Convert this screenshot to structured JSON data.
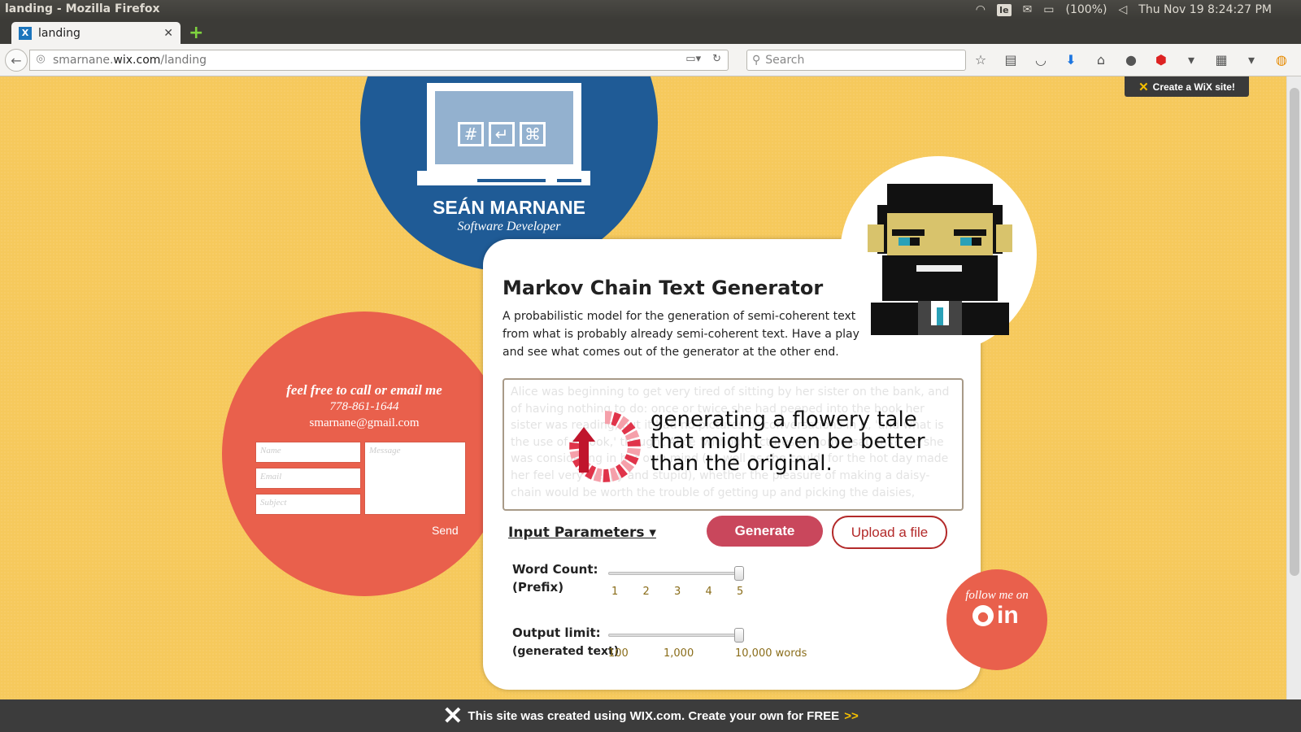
{
  "system": {
    "window_title": "landing - Mozilla Firefox",
    "battery": "(100%)",
    "clock": "Thu Nov 19  8:24:27 PM",
    "kb_layout": "Ie"
  },
  "browser": {
    "tab_title": "landing",
    "url_prefix": "smarnane.",
    "url_domain": "wix.com",
    "url_path": "/landing",
    "search_placeholder": "Search"
  },
  "profile": {
    "name": "SEÁN MARNANE",
    "role": "Software Developer"
  },
  "contact": {
    "title": "feel free to call or email me",
    "phone": "778-861-1644",
    "email": "smarnane@gmail.com",
    "name_placeholder": "Name",
    "email_placeholder": "Email",
    "subject_placeholder": "Subject",
    "message_placeholder": "Message",
    "send_label": "Send"
  },
  "generator": {
    "title": "Markov Chain Text Generator",
    "description": "A probabilistic model for the generation of semi-coherent text from what is probably already semi-coherent text.  Have a play and see what comes out of the generator at the other end.",
    "input_text": "Alice was beginning to get very tired of sitting by her sister on the bank, and of having nothing to do: once or twice she had peeped into the book her sister was reading, but it had no pictures or conversations in it, 'and what is the use of a book,' thought Alice 'without pictures or conversations?' So she was considering in her own mind (as well as she could, for the hot day made her feel very sleepy and stupid), whether the pleasure of making a daisy-chain would be worth the trouble of getting up and picking the daisies,",
    "loading_message": "generating a flowery tale that might even be better than the original.",
    "input_params_label": "Input Parameters ▾",
    "generate_label": "Generate",
    "upload_label": "Upload a file",
    "word_count_label": "Word Count:",
    "word_count_sub": "(Prefix)",
    "word_count_ticks": [
      "1",
      "2",
      "3",
      "4",
      "5"
    ],
    "word_count_value": 5,
    "output_limit_label": "Output limit:",
    "output_limit_sub": "(generated text)",
    "output_limit_ticks": [
      "100",
      "1,000",
      "10,000 words"
    ],
    "output_limit_value": "10,000"
  },
  "social": {
    "follow_label": "follow me on",
    "github_icon": "github-icon",
    "linkedin_label": "in"
  },
  "wix": {
    "badge_text": "Create a WiX site!",
    "footer_text": "This site was created using WIX.com. Create your own for FREE",
    "footer_more": ">>"
  }
}
